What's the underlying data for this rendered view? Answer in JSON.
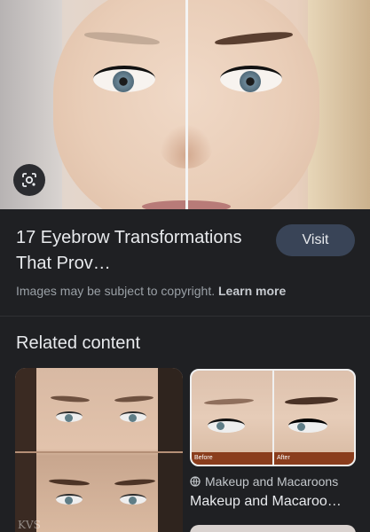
{
  "result": {
    "title": "17 Eyebrow Transformations That Prov…",
    "visit_label": "Visit",
    "copyright_text": "Images may be subject to copyright.",
    "learn_more": "Learn more"
  },
  "related": {
    "heading": "Related content",
    "left_card": {
      "watermark": "KVS"
    },
    "right_card": {
      "before_label": "Before",
      "after_label": "After",
      "source": "Makeup and Macaroons",
      "title": "Makeup and Macaroo…"
    }
  },
  "icons": {
    "lens": "google-lens-icon",
    "source": "globe-icon"
  },
  "colors": {
    "background": "#1f2023",
    "visit_button": "#394457",
    "text_primary": "#e8eaed",
    "text_secondary": "#9aa0a6"
  }
}
